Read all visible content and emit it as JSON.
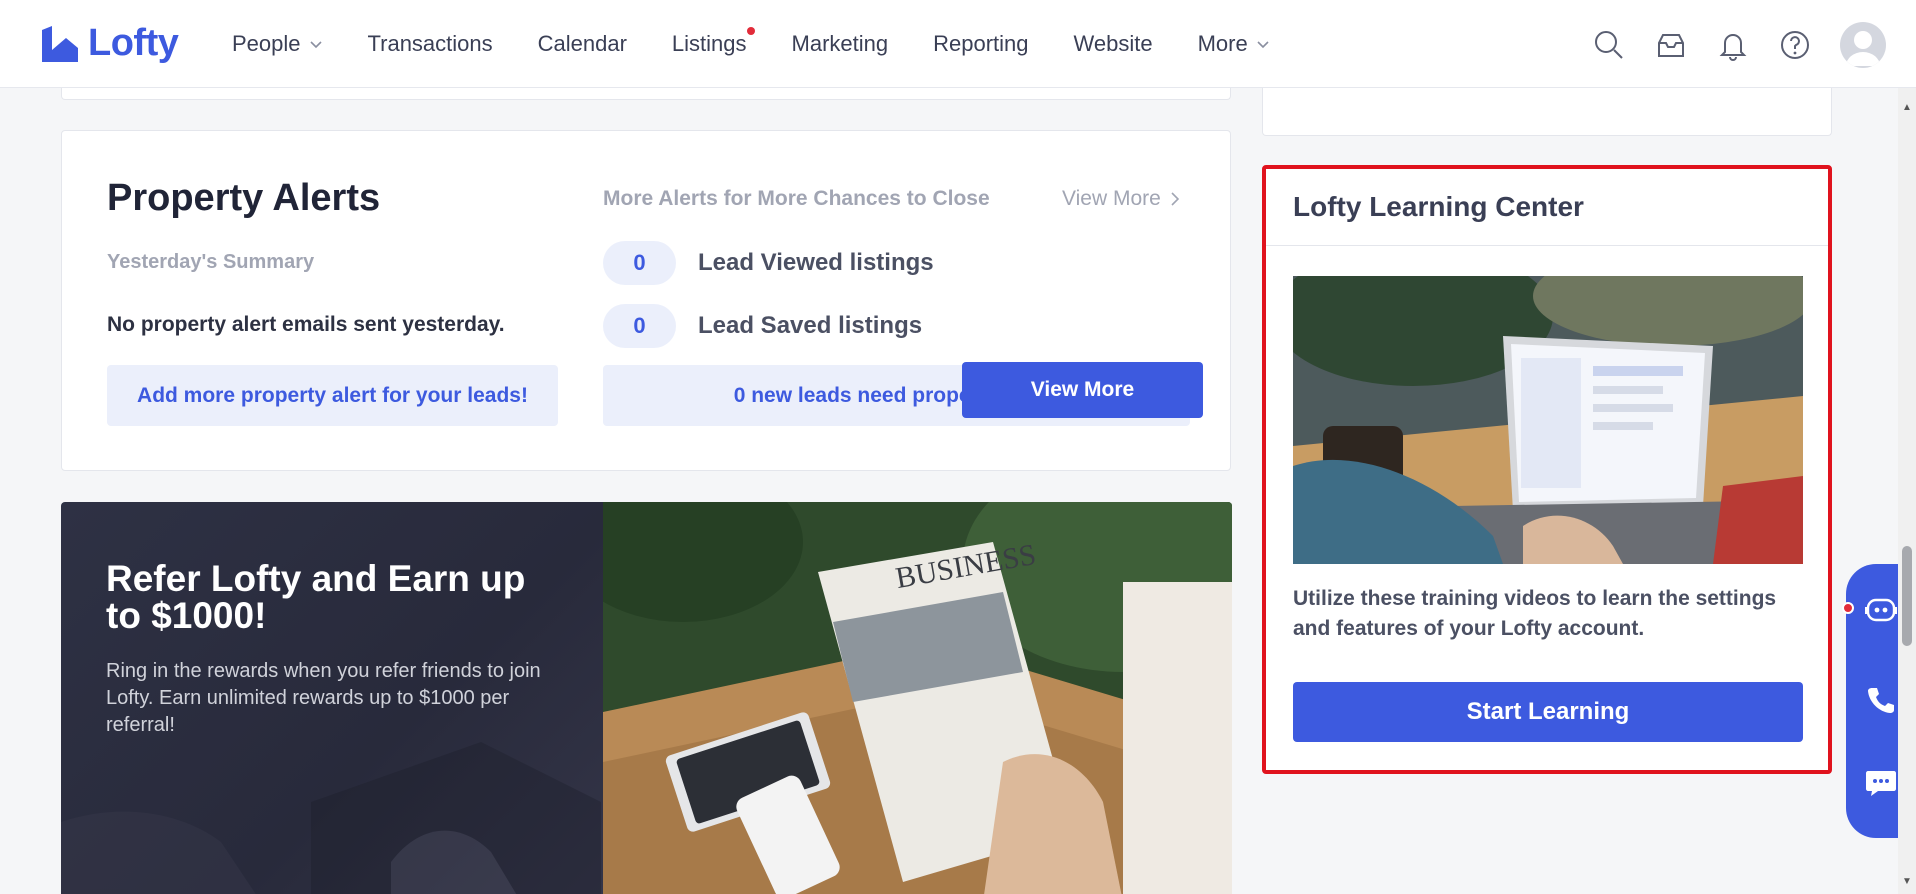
{
  "app": {
    "logo_text": "Lofty",
    "brand_color": "#3d5adf"
  },
  "nav": {
    "items": [
      {
        "label": "People",
        "has_dropdown": true
      },
      {
        "label": "Transactions"
      },
      {
        "label": "Calendar"
      },
      {
        "label": "Listings",
        "has_notification": true
      },
      {
        "label": "Marketing"
      },
      {
        "label": "Reporting"
      },
      {
        "label": "Website"
      },
      {
        "label": "More",
        "has_dropdown": true
      }
    ],
    "icons": [
      "search-icon",
      "inbox-icon",
      "bell-icon",
      "help-icon",
      "avatar"
    ]
  },
  "property_alerts": {
    "title": "Property Alerts",
    "subtitle": "Yesterday's Summary",
    "no_emails": "No property alert emails sent yesterday.",
    "add_more": "Add more property alert for your leads!",
    "more_alerts": "More Alerts for More Chances to Close",
    "view_more": "View More",
    "metrics": [
      {
        "count": "0",
        "label": "Lead Viewed listings"
      },
      {
        "count": "0",
        "label": "Lead Saved listings"
      }
    ],
    "new_leads": "0 new leads need property alerts"
  },
  "refer": {
    "title": "Refer Lofty and Earn up to $1000!",
    "text": "Ring in the rewards when you refer friends to join Lofty. Earn unlimited rewards up to $1000 per referral!",
    "button": "View More",
    "newspaper_headline": "BUSINESS"
  },
  "learning": {
    "title": "Lofty Learning Center",
    "text": "Utilize these training videos to learn the settings and features of your Lofty account.",
    "button": "Start Learning",
    "highlight_color": "#e0131e"
  },
  "support": {
    "icons": [
      "chatbot-icon",
      "phone-icon",
      "message-icon"
    ]
  }
}
